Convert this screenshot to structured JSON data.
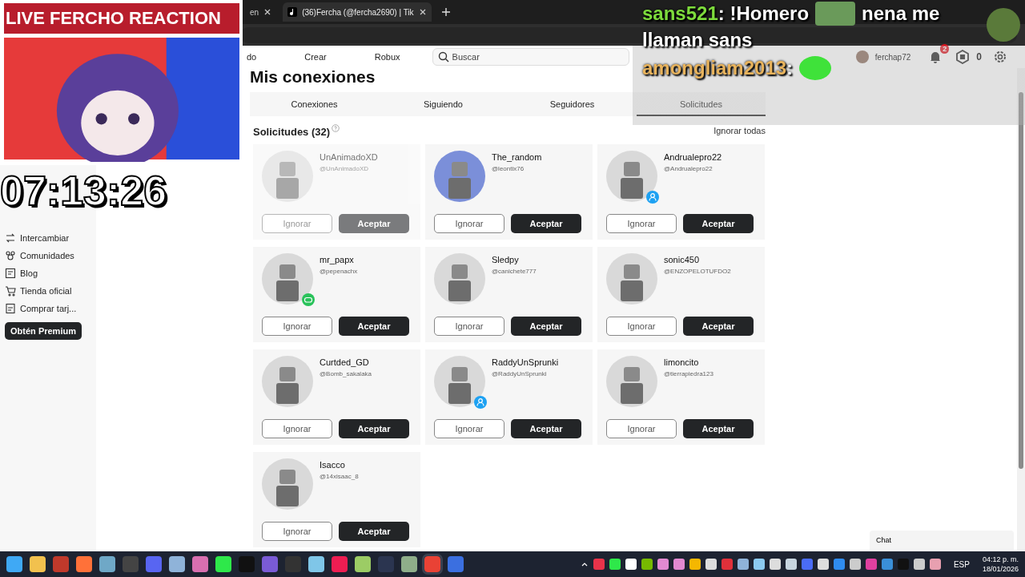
{
  "browser": {
    "tabs": [
      {
        "title": "en",
        "selected": false
      },
      {
        "title": "(36)Fercha (@fercha2690) | Tik",
        "selected": true
      }
    ]
  },
  "nav": {
    "items": [
      "do",
      "Crear",
      "Robux"
    ],
    "search": {
      "placeholder": "Buscar"
    },
    "user": "ferchap72",
    "notifications": "2",
    "robux": "0"
  },
  "sidebar": {
    "items": [
      {
        "label": "Intercambiar"
      },
      {
        "label": "Comunidades"
      },
      {
        "label": "Blog"
      },
      {
        "label": "Tienda oficial"
      },
      {
        "label": "Comprar tarj..."
      }
    ],
    "premium": "Obtén Premium"
  },
  "page": {
    "title": "Mis conexiones",
    "tabs": [
      {
        "label": "Conexiones",
        "selected": false
      },
      {
        "label": "Siguiendo",
        "selected": false
      },
      {
        "label": "Seguidores",
        "selected": false
      },
      {
        "label": "Solicitudes",
        "selected": true
      }
    ],
    "section": "Solicitudes (32)",
    "ignore_all": "Ignorar todas",
    "requests": [
      {
        "name": "UnAnimadoXD",
        "handle": "@UnAnimadoXD",
        "disabled": true,
        "kind": "plain",
        "ignore": "Ignorar",
        "accept": "Aceptar"
      },
      {
        "name": "The_random",
        "handle": "@leontix76",
        "disabled": false,
        "kind": "plain",
        "ignore": "Ignorar",
        "accept": "Aceptar"
      },
      {
        "name": "Andrualepro22",
        "handle": "@Andrualepro22",
        "disabled": false,
        "kind": "profile",
        "ignore": "Ignorar",
        "accept": "Aceptar"
      },
      {
        "name": "mr_papx",
        "handle": "@pepenachx",
        "disabled": false,
        "kind": "game",
        "ignore": "Ignorar",
        "accept": "Aceptar"
      },
      {
        "name": "Sledpy",
        "handle": "@canichete777",
        "disabled": false,
        "kind": "plain",
        "ignore": "Ignorar",
        "accept": "Aceptar"
      },
      {
        "name": "sonic450",
        "handle": "@ENZOPELOTUFDO2",
        "disabled": false,
        "kind": "plain",
        "ignore": "Ignorar",
        "accept": "Aceptar"
      },
      {
        "name": "Curtded_GD",
        "handle": "@Bomb_sakalaka",
        "disabled": false,
        "kind": "plain",
        "ignore": "Ignorar",
        "accept": "Aceptar"
      },
      {
        "name": "RaddyUnSprunki",
        "handle": "@RaddyUnSprunki",
        "disabled": false,
        "kind": "profile",
        "ignore": "Ignorar",
        "accept": "Aceptar"
      },
      {
        "name": "limoncito",
        "handle": "@tierrapiedra123",
        "disabled": false,
        "kind": "plain",
        "ignore": "Ignorar",
        "accept": "Aceptar"
      },
      {
        "name": "Isacco",
        "handle": "@14xisaac_8",
        "disabled": false,
        "kind": "plain",
        "ignore": "Ignorar",
        "accept": "Aceptar"
      }
    ]
  },
  "chat_widget": "Chat",
  "overlay": {
    "title": "LIVE FERCHO REACTION",
    "timer": "07:13:26",
    "chat": [
      {
        "user": "sans521",
        "color": "#7ddb3c",
        "parts": [
          {
            "kind": "text",
            "text": ": !Homero"
          },
          {
            "kind": "emote"
          },
          {
            "kind": "text",
            "text": "nena me"
          },
          {
            "kind": "text",
            "text": "llaman sans"
          }
        ]
      },
      {
        "user": "amongliam2013",
        "color": "#e8b35c",
        "parts": [
          {
            "kind": "text",
            "text": ":"
          },
          {
            "kind": "emote"
          }
        ]
      }
    ]
  },
  "taskbar": {
    "apps": [
      {
        "color": "#3fa9f5",
        "selected": false
      },
      {
        "color": "#f2c14e",
        "selected": false
      },
      {
        "color": "#c0392b",
        "selected": false
      },
      {
        "color": "#ff7139",
        "selected": false
      },
      {
        "color": "#6fa8c7",
        "selected": false
      },
      {
        "color": "#444444",
        "selected": false
      },
      {
        "color": "#5865f2",
        "selected": false
      },
      {
        "color": "#8fb3d9",
        "selected": false
      },
      {
        "color": "#d96fb0",
        "selected": false
      },
      {
        "color": "#2ee84a",
        "selected": false
      },
      {
        "color": "#111111",
        "selected": false
      },
      {
        "color": "#7a5bd6",
        "selected": false
      },
      {
        "color": "#333333",
        "selected": false
      },
      {
        "color": "#7fc6e8",
        "selected": false
      },
      {
        "color": "#ee1d52",
        "selected": false
      },
      {
        "color": "#9ccc65",
        "selected": false
      },
      {
        "color": "#2b3550",
        "selected": false
      },
      {
        "color": "#8fae8a",
        "selected": false
      },
      {
        "color": "#e94235",
        "selected": true
      },
      {
        "color": "#3b6fe0",
        "selected": false
      }
    ],
    "tray": [
      {
        "color": "#e8334a"
      },
      {
        "color": "#2ee84a"
      },
      {
        "color": "#ffffff"
      },
      {
        "color": "#76b900"
      },
      {
        "color": "#e28ad1"
      },
      {
        "color": "#e28ad1"
      },
      {
        "color": "#f5b700"
      },
      {
        "color": "#dddddd"
      },
      {
        "color": "#e0303a"
      },
      {
        "color": "#8fb3d9"
      },
      {
        "color": "#8ccaf0"
      },
      {
        "color": "#dddddd"
      },
      {
        "color": "#c7d5e0"
      },
      {
        "color": "#4a6cf7"
      },
      {
        "color": "#dddddd"
      },
      {
        "color": "#2f8cf0"
      },
      {
        "color": "#cccccc"
      },
      {
        "color": "#e040a0"
      },
      {
        "color": "#3a8fd8"
      },
      {
        "color": "#111111"
      },
      {
        "color": "#cccccc"
      },
      {
        "color": "#e8a0b0"
      }
    ],
    "language": "ESP",
    "time": "04:12 p. m.",
    "date": "18/01/2026"
  }
}
